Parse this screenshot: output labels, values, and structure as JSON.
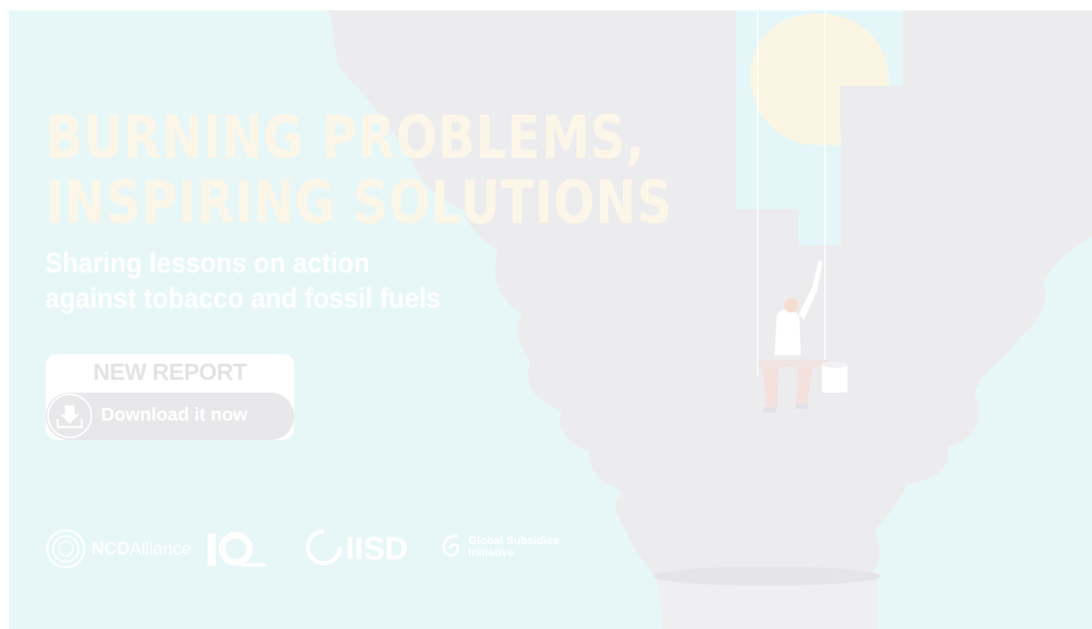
{
  "banner": {
    "headline": {
      "line1": "BURNING PROBLEMS,",
      "line2": "INSPIRING SOLUTIONS"
    },
    "subheadline": {
      "line1": "Sharing lessons on action",
      "line2": "against tobacco and fossil fuels"
    },
    "cta": {
      "label": "NEW REPORT",
      "button": "Download it now"
    },
    "logos": {
      "ncd_bold": "NCD",
      "ncd_rest": "Alliance",
      "iisd": "IISD",
      "gsi_line1": "Global Subsidies",
      "gsi_line2": "Initiative"
    },
    "icons": [
      "download-icon",
      "ncd-alliance-logo",
      "ncd-10-years-logo",
      "iisd-logo",
      "gsi-logo",
      "sun",
      "painter-figure",
      "paint-bucket"
    ],
    "colors": {
      "background": "#e7f7f8",
      "smoke": "#ececef",
      "headline": "#fbf6e7",
      "sun": "#fbf6e4",
      "button": "#e8e8eb"
    }
  }
}
